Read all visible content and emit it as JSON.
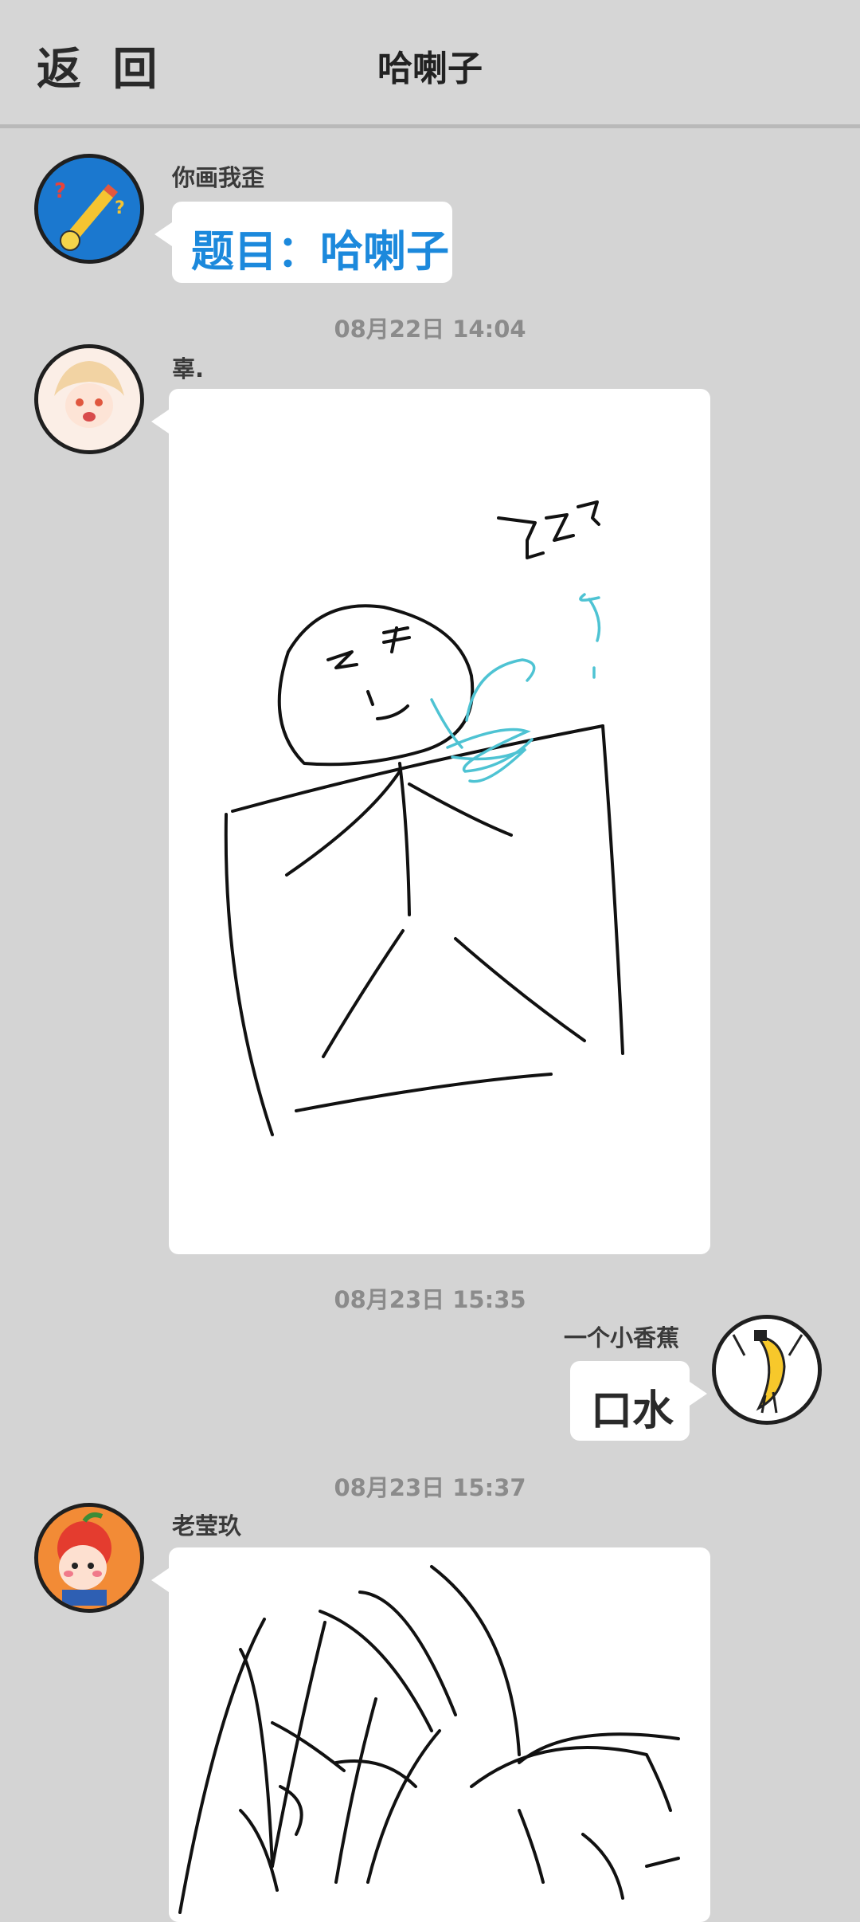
{
  "header": {
    "back_label": "返 回",
    "title": "哈喇子"
  },
  "messages": [
    {
      "sender": "你画我歪",
      "text": "题目：哈喇子"
    },
    {
      "time": "08月22日  14:04",
      "sender": "辜.",
      "drawing_text": "ZZZ"
    },
    {
      "time": "08月23日  15:35",
      "sender": "一个小香蕉",
      "text": "口水"
    },
    {
      "time": "08月23日  15:37",
      "sender": "老莹玖"
    }
  ],
  "colors": {
    "topic": "#1c89dc",
    "background": "#d4d4d4",
    "drool": "#4ec3d3"
  }
}
